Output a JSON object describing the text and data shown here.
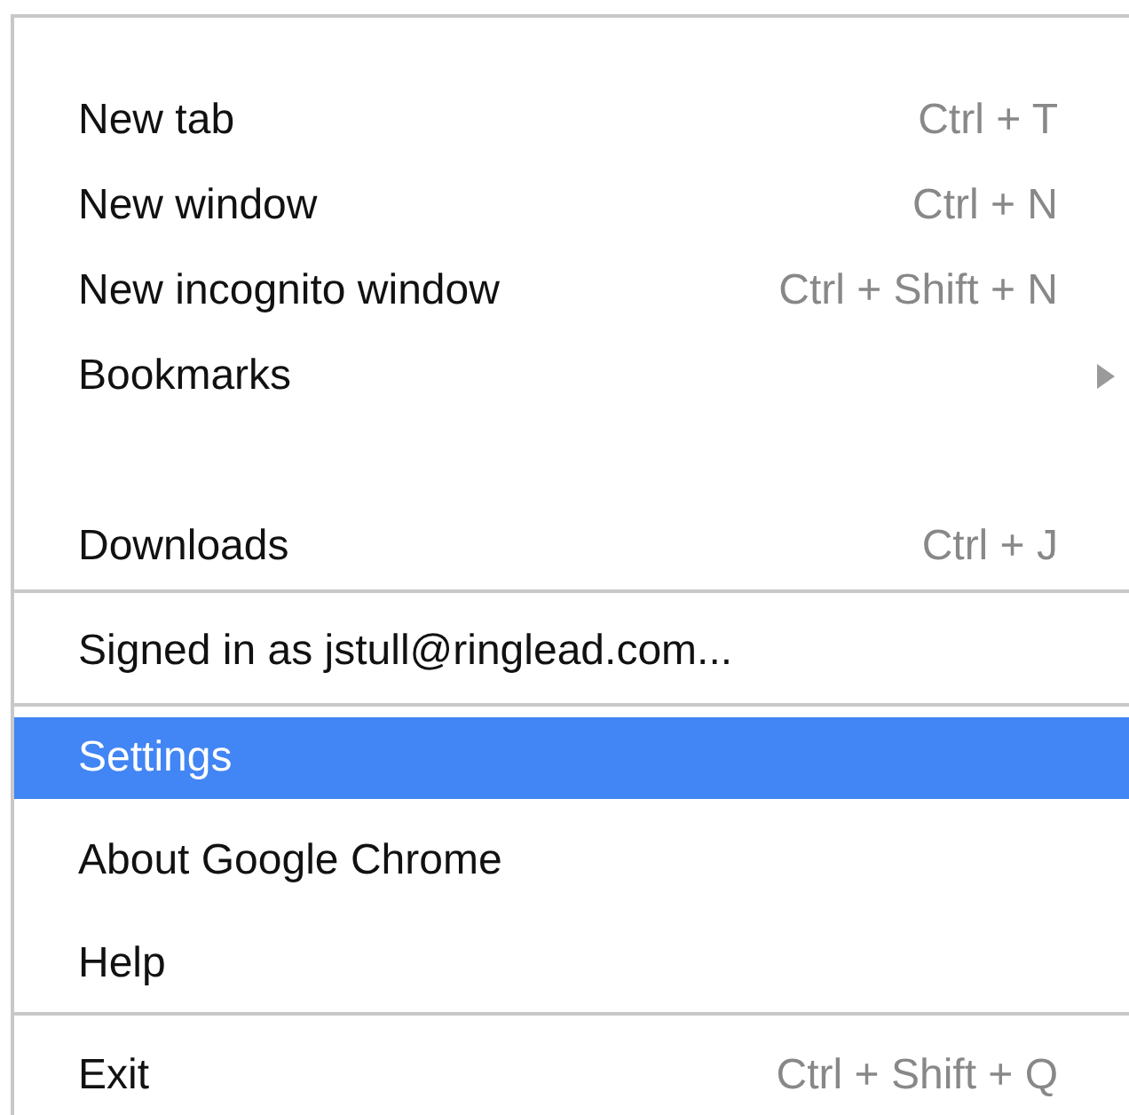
{
  "menu": {
    "groups": [
      {
        "items": [
          {
            "label": "New tab",
            "shortcut": "Ctrl + T",
            "selected": false,
            "submenu": false
          },
          {
            "label": "New window",
            "shortcut": "Ctrl + N",
            "selected": false,
            "submenu": false
          },
          {
            "label": "New incognito window",
            "shortcut": "Ctrl + Shift + N",
            "selected": false,
            "submenu": false
          },
          {
            "label": "Bookmarks",
            "selected": false,
            "submenu": true
          },
          {
            "label": "Downloads",
            "shortcut": "Ctrl + J",
            "selected": false,
            "submenu": false
          }
        ]
      },
      {
        "items": [
          {
            "label": "Signed in as jstull@ringlead.com...",
            "selected": false,
            "submenu": false
          }
        ]
      },
      {
        "items": [
          {
            "label": "Settings",
            "selected": true,
            "submenu": false
          },
          {
            "label": "About Google Chrome",
            "selected": false,
            "submenu": false
          },
          {
            "label": "Help",
            "selected": false,
            "submenu": false
          }
        ]
      },
      {
        "items": [
          {
            "label": "Exit",
            "shortcut": "Ctrl + Shift + Q",
            "selected": false,
            "submenu": false
          }
        ]
      }
    ]
  }
}
